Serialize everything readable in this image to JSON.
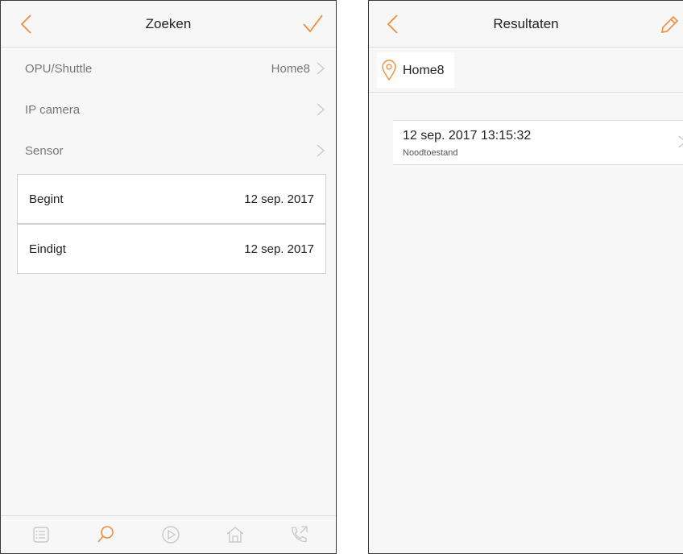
{
  "left": {
    "title": "Zoeken",
    "rows": [
      {
        "label": "OPU/Shuttle",
        "value": "Home8"
      },
      {
        "label": "IP camera",
        "value": ""
      },
      {
        "label": "Sensor",
        "value": ""
      }
    ],
    "dates": [
      {
        "label": "Begint",
        "value": "12 sep. 2017"
      },
      {
        "label": "Eindigt",
        "value": "12 sep. 2017"
      }
    ],
    "tabs": [
      "list-icon",
      "search-icon",
      "play-icon",
      "home-icon",
      "phone-icon"
    ],
    "active_tab": "search-icon"
  },
  "right": {
    "title": "Resultaten",
    "location": "Home8",
    "results": [
      {
        "timestamp": "12 sep. 2017 13:15:32",
        "subtitle": "Noodtoestand"
      }
    ]
  },
  "colors": {
    "accent": "#f28c3c",
    "muted": "#c8c8c8",
    "text": "#222222",
    "secondary_text": "#777777"
  }
}
